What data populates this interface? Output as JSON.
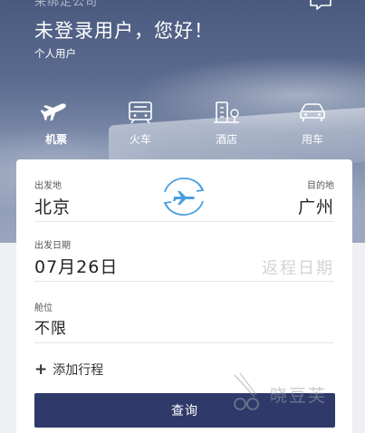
{
  "header": {
    "company": "来绑定公司",
    "greeting": "未登录用户，您好！",
    "user_type": "个人用户"
  },
  "tabs": [
    {
      "label": "机票",
      "icon": "plane-icon",
      "active": true
    },
    {
      "label": "火车",
      "icon": "train-icon",
      "active": false
    },
    {
      "label": "酒店",
      "icon": "hotel-icon",
      "active": false
    },
    {
      "label": "用车",
      "icon": "car-icon",
      "active": false
    }
  ],
  "form": {
    "from_label": "出发地",
    "from_city": "北京",
    "to_label": "目的地",
    "to_city": "广州",
    "depart_label": "出发日期",
    "depart_date": "07月26日",
    "return_placeholder": "返程日期",
    "cabin_label": "舱位",
    "cabin_value": "不限",
    "add_trip": "添加行程",
    "search": "查询"
  },
  "watermark": {
    "text": "晓豆芙"
  },
  "colors": {
    "primary": "#2f3a6a",
    "accent": "#4a9fe0"
  }
}
